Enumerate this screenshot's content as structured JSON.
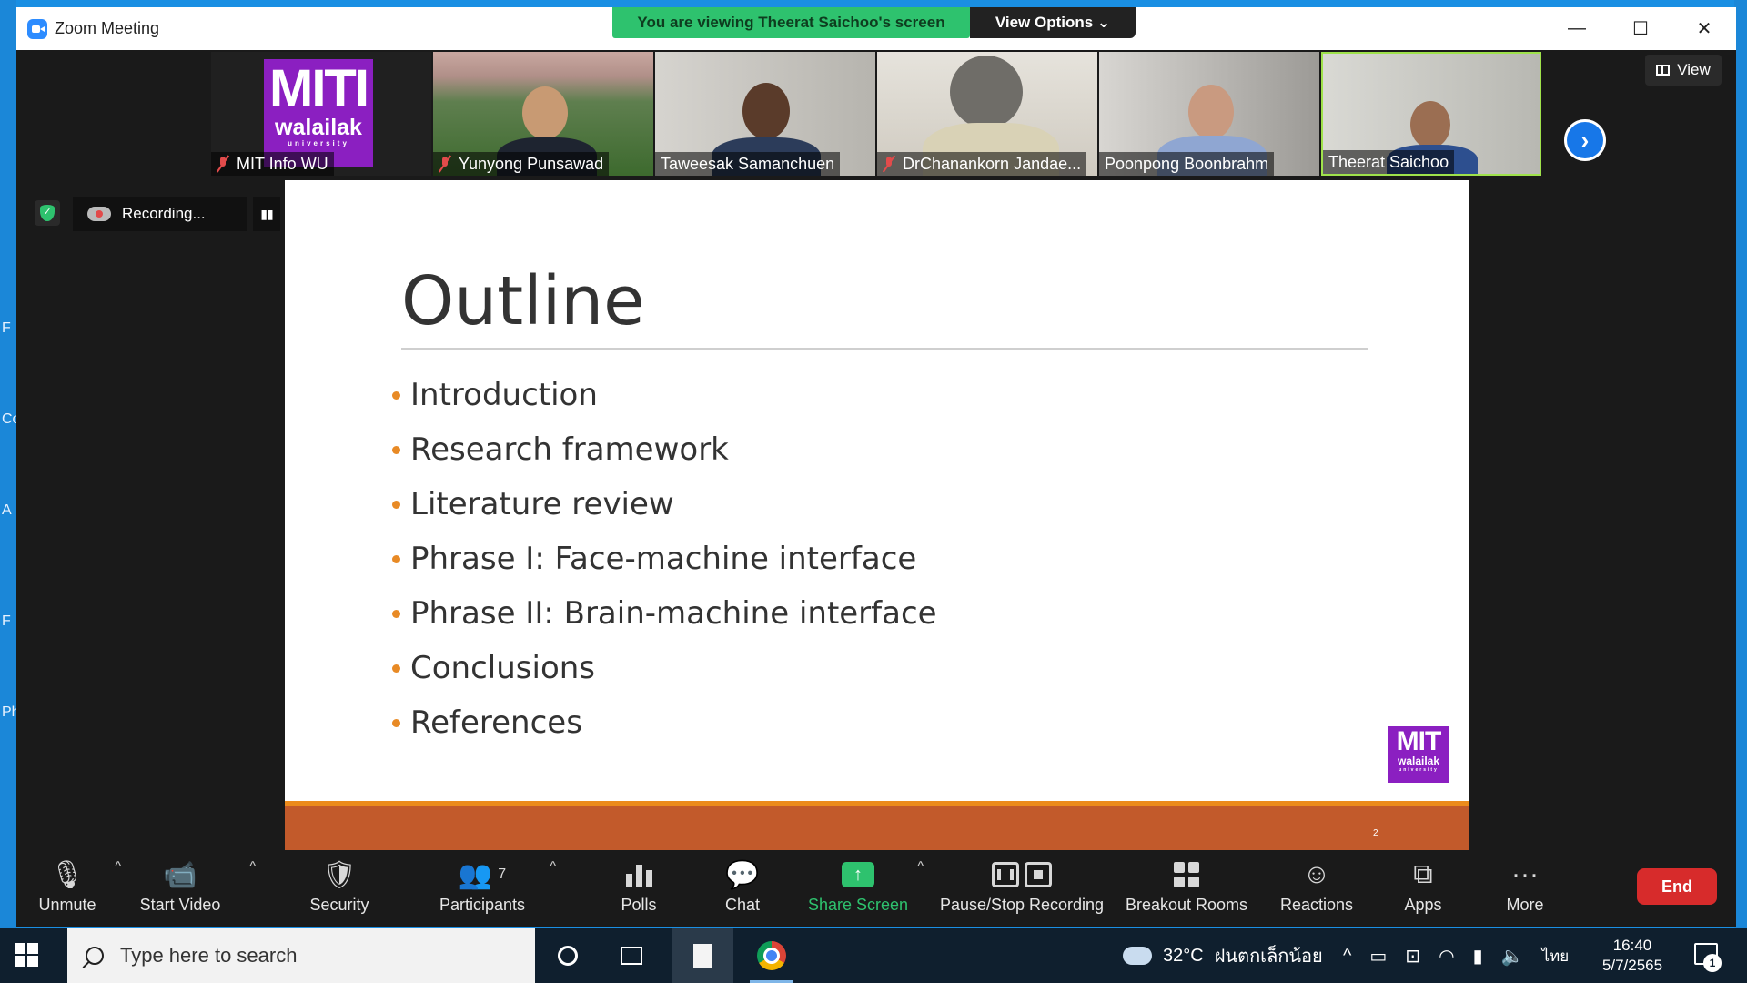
{
  "window": {
    "title": "Zoom Meeting",
    "minimize": "—",
    "maximize": "☐",
    "close": "✕"
  },
  "share_banner": {
    "text": "You are viewing Theerat Saichoo's screen",
    "view_options": "View Options ⌄"
  },
  "thumbnails": [
    {
      "name": "MIT Info WU",
      "muted": true,
      "logo_big": "MITI",
      "logo_small": "walailak",
      "logo_tiny": "university"
    },
    {
      "name": "Yunyong Punsawad",
      "muted": true
    },
    {
      "name": "Taweesak Samanchuen",
      "muted": false
    },
    {
      "name": "DrChanankorn Jandae...",
      "muted": true
    },
    {
      "name": "Poonpong Boonbrahm",
      "muted": false
    },
    {
      "name": "Theerat Saichoo",
      "muted": false,
      "active": true
    }
  ],
  "view_button": "View",
  "recording": {
    "label": "Recording...",
    "pause": "▮▮"
  },
  "slide": {
    "title": "Outline",
    "bullets": [
      "Introduction",
      "Research framework",
      "Literature review",
      "Phrase I: Face-machine interface",
      "Phrase II: Brain-machine interface",
      "Conclusions",
      "References"
    ],
    "logo_big": "MIT",
    "logo_small": "walailak",
    "logo_tiny": "university",
    "page_number": "2",
    "accent_colors": {
      "bar": "#c25a2b",
      "bar_top": "#ec8b1c",
      "bullet": "#e88a25",
      "logo": "#8b1fc1"
    }
  },
  "toolbar": {
    "unmute": "Unmute",
    "start_video": "Start Video",
    "security": "Security",
    "participants": "Participants",
    "participants_count": "7",
    "polls": "Polls",
    "chat": "Chat",
    "share_screen": "Share Screen",
    "pause_stop_recording": "Pause/Stop Recording",
    "breakout_rooms": "Breakout Rooms",
    "reactions": "Reactions",
    "apps": "Apps",
    "more": "More",
    "end": "End",
    "caret": "^"
  },
  "taskbar": {
    "search_placeholder": "Type here to search",
    "temperature": "32°C",
    "weather": "ฝนตกเล็กน้อย",
    "language": "ไทย",
    "time": "16:40",
    "date": "5/7/2565",
    "notification_count": "1",
    "chevron": "^"
  },
  "desktop_edge_letters": [
    "F",
    "Co",
    "A",
    "F",
    "Ph"
  ]
}
